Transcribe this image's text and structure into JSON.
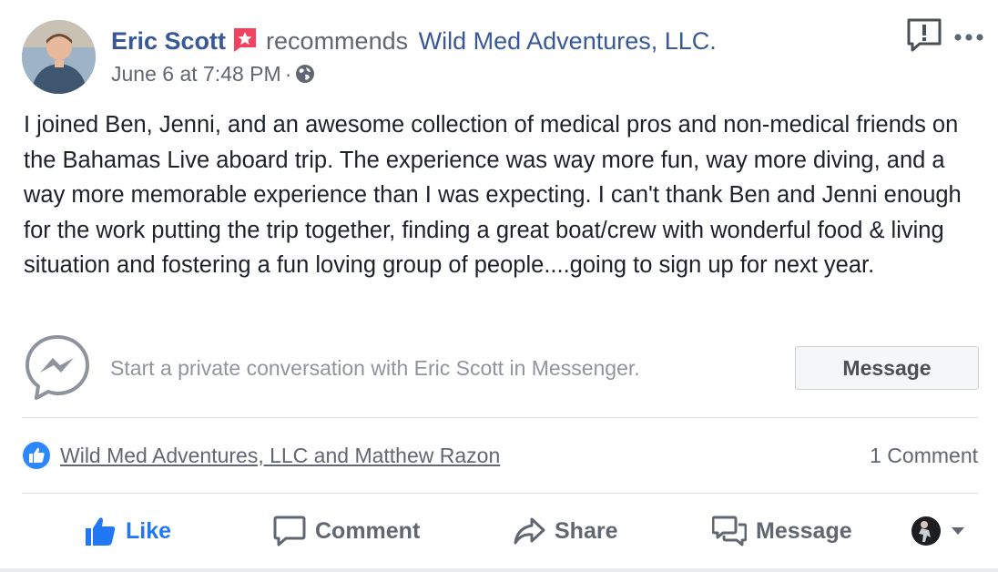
{
  "post": {
    "author": "Eric Scott",
    "verb": "recommends",
    "page": "Wild Med Adventures, LLC.",
    "timestamp": "June 6 at 7:48 PM",
    "separator": "·",
    "body": "I joined Ben, Jenni, and an awesome collection of medical pros and non-medical friends on the Bahamas Live aboard trip. The experience was way more fun, way more diving, and a way more memorable experience than I was expecting. I can't thank Ben and Jenni enough for the work putting the trip together, finding a great boat/crew with wonderful food & living situation and fostering a fun loving group of people....going to sign up for next year."
  },
  "messenger": {
    "prompt": "Start a private conversation with Eric Scott in Messenger.",
    "button_label": "Message"
  },
  "reactions": {
    "reactors": "Wild Med Adventures, LLC and Matthew Razon",
    "comment_count": "1 Comment"
  },
  "actions": {
    "like": "Like",
    "comment": "Comment",
    "share": "Share",
    "message": "Message"
  },
  "icons": {
    "recommend_badge": "star-flag-icon",
    "privacy": "globe-icon",
    "report": "report-icon",
    "more": "more-icon",
    "messenger": "messenger-icon",
    "like_badge": "like-badge-icon"
  },
  "colors": {
    "link": "#385898",
    "like_active": "#2078f4",
    "secondary_text": "#606770",
    "recommend_badge": "#f3425f"
  }
}
